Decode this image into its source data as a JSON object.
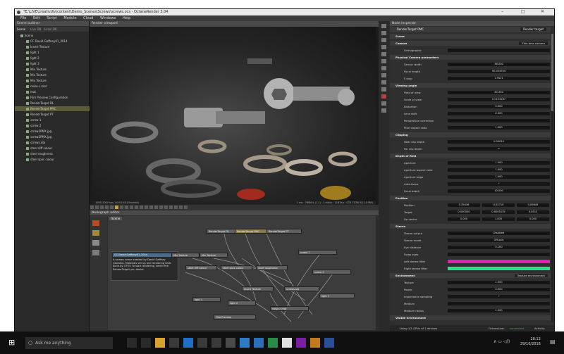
{
  "window": {
    "title": "*E:\\LIVE\\creativdiv\\content\\Demo_Scenes\\Screws\\screws.ocs - OctaneRender 3.04",
    "controls": [
      "–",
      "□",
      "✕"
    ]
  },
  "menu": [
    "File",
    "Edit",
    "Script",
    "Module",
    "Cloud",
    "Windows",
    "Help"
  ],
  "outliner": {
    "header": "Scene outliner",
    "tabs": [
      "Scene",
      "Live DB",
      "Local DB"
    ],
    "items": [
      {
        "label": "Scene",
        "selected": false
      },
      {
        "label": "CC David Gaffney01_2014",
        "selected": false
      },
      {
        "label": "Insert Texture",
        "selected": false
      },
      {
        "label": "light 1",
        "selected": false
      },
      {
        "label": "light 2",
        "selected": false
      },
      {
        "label": "light 3",
        "selected": false
      },
      {
        "label": "Mix Texture",
        "selected": false
      },
      {
        "label": "Mix Texture",
        "selected": false
      },
      {
        "label": "Mix Texture",
        "selected": false
      },
      {
        "label": "noise.c.mat",
        "selected": false
      },
      {
        "label": "mat",
        "selected": false
      },
      {
        "label": "Film Preview Configuration",
        "selected": false
      },
      {
        "label": "RenderTarget DL",
        "selected": false
      },
      {
        "label": "RenderTarget PMC",
        "selected": true
      },
      {
        "label": "RenderTarget PT",
        "selected": false
      },
      {
        "label": "screw 1",
        "selected": false
      },
      {
        "label": "screw 2",
        "selected": false
      },
      {
        "label": "screw2PMX.jpg",
        "selected": false
      },
      {
        "label": "screw2PMX.jpg",
        "selected": false
      },
      {
        "label": "screws.obj",
        "selected": false
      },
      {
        "label": "steel diff colour",
        "selected": false
      },
      {
        "label": "steel roughness",
        "selected": false
      },
      {
        "label": "steel spec colour",
        "selected": false
      }
    ]
  },
  "viewport": {
    "header": "Render viewport",
    "status_left": "1061/1000 sec. 00:01:45 (Finished)",
    "status_right": "1 ms · 768kFx (1.1) · 1 mesh · 1181Kp · GTX TITAN X (1.0 MB)"
  },
  "nodegraph": {
    "header": "Nodegraph editor",
    "tab": "Scene",
    "note_title": "CC David Gaffney01_2014",
    "note_text": "A screws scene created by David Gaffney (davidG). Materials set up and rendering tests done by OTOY. To start rendering, select the RenderTarget you desire.",
    "nodes": [
      "RenderTarget DL",
      "RenderTarget PMC",
      "RenderTarget PT",
      "Mix Texture",
      "Mix Texture",
      "steel diff colour",
      "steel spec colour",
      "steel roughness",
      "screw 1",
      "screw 2",
      "screws.obj",
      "Insert Texture",
      "light 1",
      "light 2",
      "light 3",
      "noise.c.mat",
      "Film Preview"
    ]
  },
  "inspector": {
    "header": "Node inspector",
    "target_label": "RenderTarget PMC",
    "target_type": "Render target",
    "rows": [
      {
        "type": "section",
        "label": "Scene"
      },
      {
        "type": "section",
        "label": "Camera",
        "value": "Thin lens camera"
      },
      {
        "type": "prop",
        "label": "Orthographic",
        "value": ""
      },
      {
        "type": "section",
        "label": "Physical Camera parameters"
      },
      {
        "type": "prop",
        "label": "Sensor width",
        "value": "36.000"
      },
      {
        "type": "prop",
        "label": "Focal length",
        "value": "90.454534"
      },
      {
        "type": "prop",
        "label": "F-stop",
        "value": "1.9421"
      },
      {
        "type": "section",
        "label": "Viewing angle"
      },
      {
        "type": "prop",
        "label": "Field of view",
        "value": "40.350"
      },
      {
        "type": "prop",
        "label": "Scale of view",
        "value": "0.0124287"
      },
      {
        "type": "prop",
        "label": "Distortion",
        "value": "0.000"
      },
      {
        "type": "prop",
        "label": "Lens shift",
        "value": "0.000"
      },
      {
        "type": "prop",
        "label": "Perspective correction",
        "value": ""
      },
      {
        "type": "prop",
        "label": "Pixel aspect ratio",
        "value": "1.000"
      },
      {
        "type": "section",
        "label": "Clipping"
      },
      {
        "type": "prop",
        "label": "Near clip depth",
        "value": "0.00010"
      },
      {
        "type": "prop",
        "label": "Far clip depth",
        "value": "∞"
      },
      {
        "type": "section",
        "label": "Depth of field"
      },
      {
        "type": "prop",
        "label": "Aperture",
        "value": "1.000"
      },
      {
        "type": "prop",
        "label": "Aperture aspect ratio",
        "value": "1.000"
      },
      {
        "type": "prop",
        "label": "Aperture edge",
        "value": "1.000"
      },
      {
        "type": "prop",
        "label": "Auto-focus",
        "value": "✓"
      },
      {
        "type": "prop",
        "label": "Focal depth",
        "value": "10.000"
      },
      {
        "type": "section",
        "label": "Position"
      },
      {
        "type": "prop3",
        "label": "Position",
        "values": [
          "0.39436",
          "0.02710",
          "0.09849"
        ]
      },
      {
        "type": "prop3",
        "label": "Target",
        "values": [
          "0.000000",
          "0.0005135",
          "0.0513"
        ]
      },
      {
        "type": "prop3",
        "label": "Up-vector",
        "values": [
          "0.000",
          "1.000",
          "0.000"
        ]
      },
      {
        "type": "section",
        "label": "Stereo"
      },
      {
        "type": "prop",
        "label": "Stereo output",
        "value": "Disabled"
      },
      {
        "type": "prop",
        "label": "Stereo mode",
        "value": "Off-axis"
      },
      {
        "type": "prop",
        "label": "Eye distance",
        "value": "0.100"
      },
      {
        "type": "prop",
        "label": "Swap eyes",
        "value": ""
      },
      {
        "type": "color",
        "label": "Left stereo filter",
        "value": "#e01fb8"
      },
      {
        "type": "color",
        "label": "Right stereo filter",
        "value": "#2fe08a"
      },
      {
        "type": "section",
        "label": "Environment",
        "value": "Texture environment"
      },
      {
        "type": "prop",
        "label": "Texture",
        "value": "1.000"
      },
      {
        "type": "prop",
        "label": "Power",
        "value": "0.500"
      },
      {
        "type": "prop",
        "label": "Importance sampling",
        "value": "✓"
      },
      {
        "type": "prop",
        "label": "Medium",
        "value": ""
      },
      {
        "type": "prop",
        "label": "Medium radius",
        "value": "1.000"
      },
      {
        "type": "section",
        "label": "Visible environment"
      }
    ],
    "footer_left": "Using 1/1 GPUs of 1 devices",
    "footer_mid": "OctaneLive:",
    "footer_status": "connected",
    "footer_right": "Activity:"
  },
  "taskbar": {
    "search_placeholder": "Ask me anything",
    "time": "18:13",
    "date": "29/10/2016"
  },
  "colors": {
    "selection": "#5b5b3a",
    "left_filter": "#e01fb8",
    "right_filter": "#2fe08a",
    "live_status": "#4caf50"
  }
}
